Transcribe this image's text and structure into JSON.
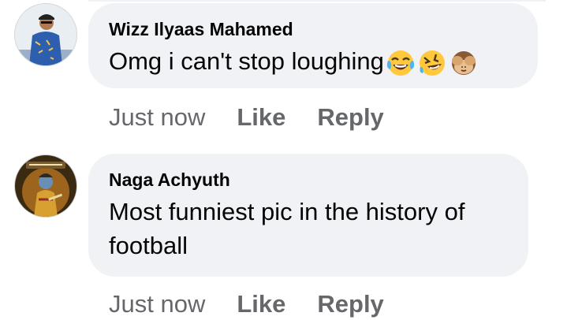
{
  "comments": [
    {
      "author": "Wizz Ilyaas Mahamed",
      "text": "Omg i can't stop loughing",
      "emojis": [
        "face-with-tears-of-joy-icon",
        "rolling-on-floor-laughing-icon",
        "see-no-evil-monkey-icon"
      ],
      "time": "Just now",
      "like_label": "Like",
      "reply_label": "Reply"
    },
    {
      "author": "Naga Achyuth",
      "text": "Most funniest pic in the history of football",
      "time": "Just now",
      "like_label": "Like",
      "reply_label": "Reply"
    }
  ],
  "colors": {
    "bubble_bg": "#f0f2f5",
    "text": "#050505",
    "meta_text": "#65676b"
  }
}
